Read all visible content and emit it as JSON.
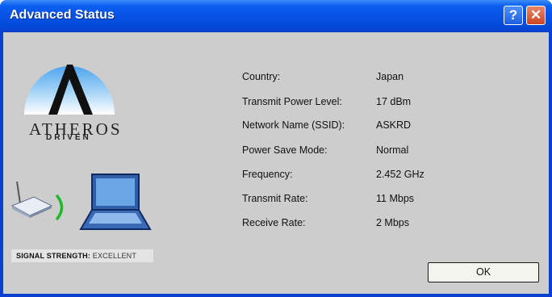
{
  "window": {
    "title": "Advanced Status",
    "help_glyph": "?",
    "close_glyph": "✕"
  },
  "logo": {
    "brand": "ATHEROS",
    "tagline": "DRIVEN"
  },
  "signal": {
    "label": "SIGNAL STRENGTH:",
    "value": "EXCELLENT"
  },
  "status": [
    {
      "label": "Country:",
      "value": "Japan"
    },
    {
      "label": "Transmit Power Level:",
      "value": "17 dBm"
    },
    {
      "label": "Network Name (SSID):",
      "value": "ASKRD"
    },
    {
      "label": "Power Save Mode:",
      "value": "Normal"
    },
    {
      "label": "Frequency:",
      "value": "2.452 GHz"
    },
    {
      "label": "Transmit Rate:",
      "value": "11 Mbps"
    },
    {
      "label": "Receive Rate:",
      "value": "2 Mbps"
    }
  ],
  "buttons": {
    "ok": "OK"
  }
}
